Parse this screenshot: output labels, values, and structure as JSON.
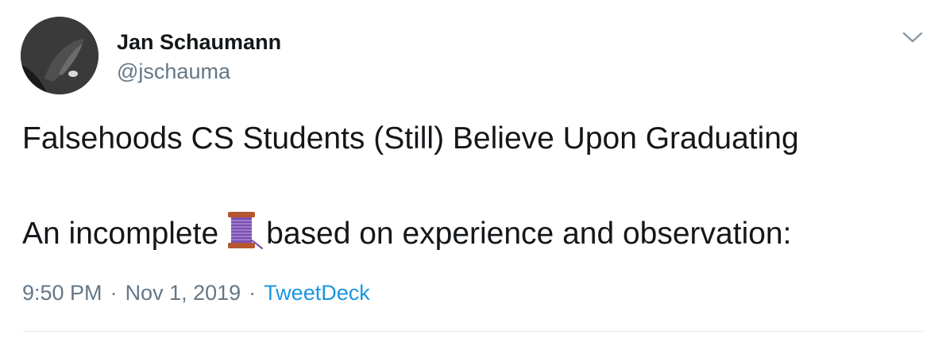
{
  "author": {
    "name": "Jan Schaumann",
    "handle": "@jschauma"
  },
  "tweet": {
    "line1": "Falsehoods CS Students (Still) Believe Upon Graduating",
    "line2_before": "An incomplete",
    "line2_emoji": "thread-spool-icon",
    "line2_after": "based on experience and observation:"
  },
  "meta": {
    "time": "9:50 PM",
    "separator": "·",
    "date": "Nov 1, 2019",
    "source": "TweetDeck"
  },
  "colors": {
    "text": "#14171a",
    "secondary": "#657786",
    "link": "#1b95e0",
    "divider": "#e6ecf0"
  }
}
